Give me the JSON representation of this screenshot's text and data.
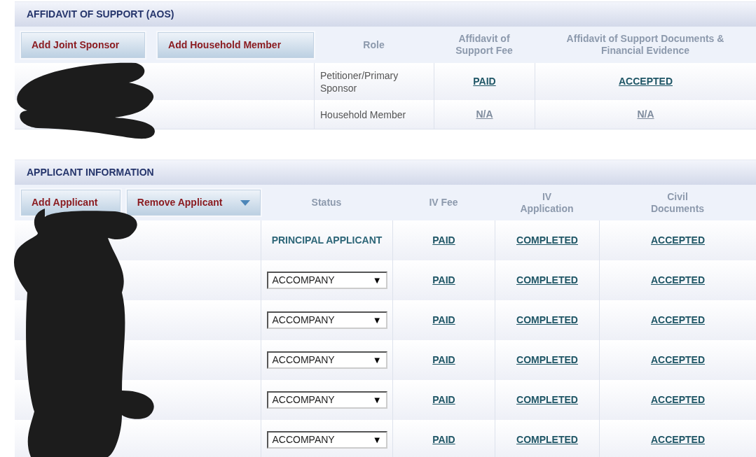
{
  "aos": {
    "title": "AFFIDAVIT OF SUPPORT (AOS)",
    "buttons": [
      "Add Joint Sponsor",
      "Add Household Member"
    ],
    "columns": [
      "Role",
      "Affidavit of Support Fee",
      "Affidavit of Support Documents & Financial Evidence"
    ],
    "rows": [
      {
        "role": "Petitioner/Primary Sponsor",
        "fee": {
          "text": "PAID",
          "disabled": false
        },
        "documents": {
          "text": "ACCEPTED",
          "disabled": false
        }
      },
      {
        "role": "Household Member",
        "fee": {
          "text": "N/A",
          "disabled": true
        },
        "documents": {
          "text": "N/A",
          "disabled": true
        }
      }
    ]
  },
  "applicants": {
    "title": "APPLICANT INFORMATION",
    "buttons": [
      {
        "label": "Add Applicant",
        "kind": "plain"
      },
      {
        "label": "Remove Applicant",
        "kind": "dropdown"
      }
    ],
    "columns": [
      "Status",
      "IV Fee",
      "IV Application",
      "Civil Documents"
    ],
    "rows": [
      {
        "status": {
          "kind": "text",
          "text": "PRINCIPAL APPLICANT"
        },
        "iv_fee": "PAID",
        "iv_application": "COMPLETED",
        "civil_documents": "ACCEPTED"
      },
      {
        "status": {
          "kind": "select",
          "value": "ACCOMPANY",
          "arrow": "▼"
        },
        "iv_fee": "PAID",
        "iv_application": "COMPLETED",
        "civil_documents": "ACCEPTED"
      },
      {
        "status": {
          "kind": "select",
          "value": "ACCOMPANY",
          "arrow": "▼"
        },
        "iv_fee": "PAID",
        "iv_application": "COMPLETED",
        "civil_documents": "ACCEPTED"
      },
      {
        "status": {
          "kind": "select",
          "value": "ACCOMPANY",
          "arrow": "▼"
        },
        "iv_fee": "PAID",
        "iv_application": "COMPLETED",
        "civil_documents": "ACCEPTED"
      },
      {
        "status": {
          "kind": "select",
          "value": "ACCOMPANY",
          "arrow": "▼"
        },
        "iv_fee": "PAID",
        "iv_application": "COMPLETED",
        "civil_documents": "ACCEPTED"
      },
      {
        "status": {
          "kind": "select",
          "value": "ACCOMPANY",
          "arrow": "▼"
        },
        "iv_fee": "PAID",
        "iv_application": "COMPLETED",
        "civil_documents": "ACCEPTED"
      }
    ]
  }
}
